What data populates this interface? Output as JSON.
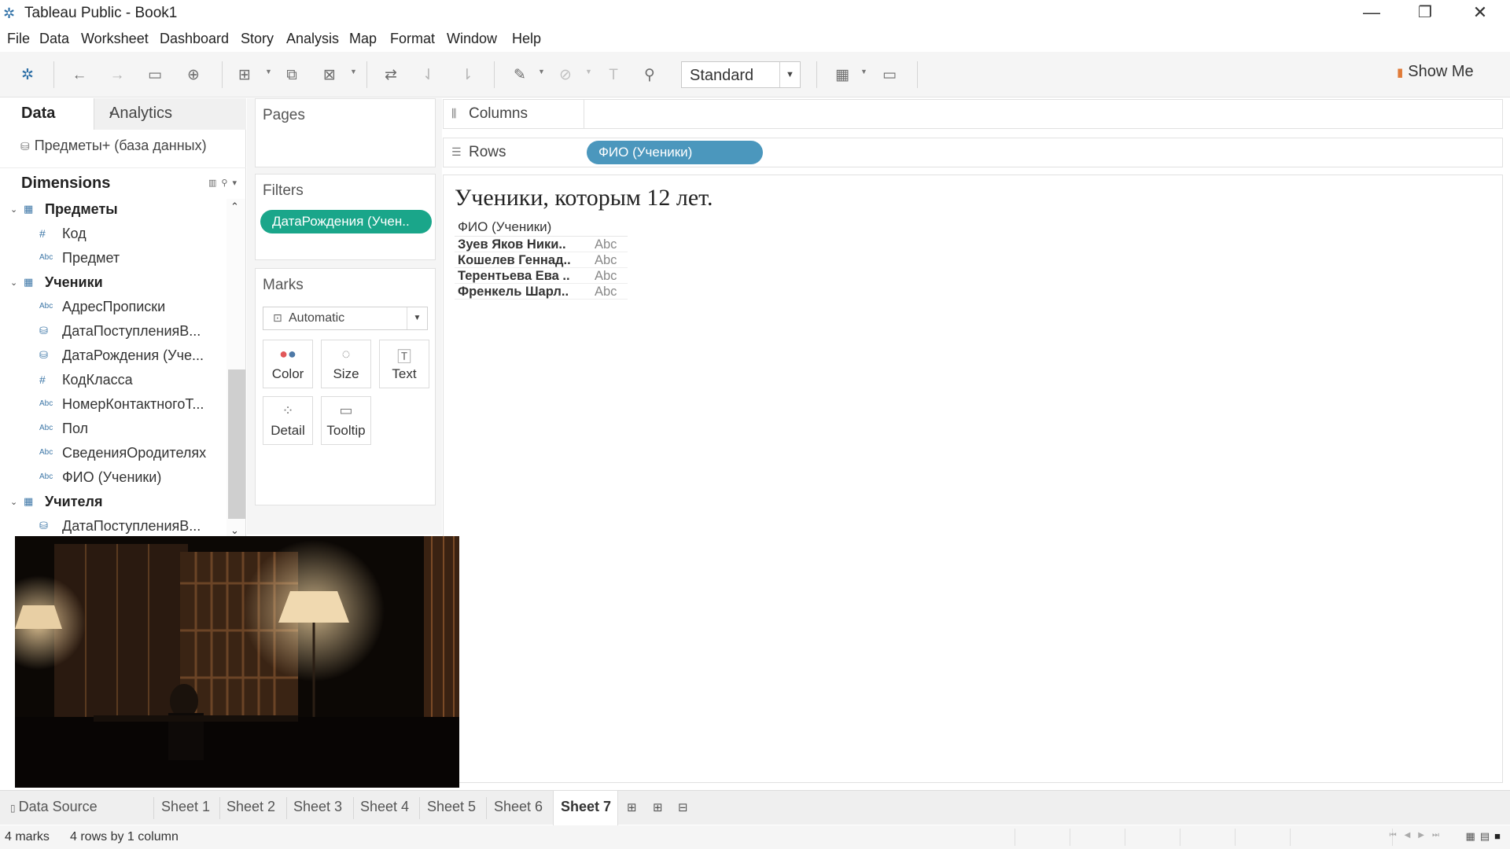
{
  "window": {
    "title": "Tableau Public - Book1",
    "controls": {
      "minimize": "—",
      "restore": "❐",
      "close": "✕"
    }
  },
  "menu": [
    "File",
    "Data",
    "Worksheet",
    "Dashboard",
    "Story",
    "Analysis",
    "Map",
    "Format",
    "Window",
    "Help"
  ],
  "toolbar": {
    "fit": "Standard",
    "show_me": "Show Me",
    "icons": [
      "tableau-logo-icon",
      "undo-icon",
      "redo-icon",
      "save-icon",
      "add-datasource-icon",
      "new-worksheet-icon",
      "duplicate-sheet-icon",
      "clear-sheet-icon",
      "swap-icon",
      "sort-ascending-icon",
      "sort-descending-icon",
      "highlight-icon",
      "group-icon",
      "show-labels-icon",
      "pin-icon",
      "show-cards-icon",
      "presentation-icon"
    ]
  },
  "data_pane": {
    "tab_data": "Data",
    "tab_analytics": "Analytics",
    "datasource": "Предметы+ (база данных)",
    "dimensions_label": "Dimensions",
    "tables": [
      {
        "name": "Предметы",
        "fields": [
          {
            "type": "#",
            "name": "Код"
          },
          {
            "type": "Abc",
            "name": "Предмет"
          }
        ]
      },
      {
        "name": "Ученики",
        "fields": [
          {
            "type": "Abc",
            "name": "АдресПрописки"
          },
          {
            "type": "date",
            "name": "ДатаПоступленияВ..."
          },
          {
            "type": "date",
            "name": "ДатаРождения (Уче..."
          },
          {
            "type": "#",
            "name": "КодКласса"
          },
          {
            "type": "Abc",
            "name": "НомерКонтактногоТ..."
          },
          {
            "type": "Abc",
            "name": "Пол"
          },
          {
            "type": "Abc",
            "name": "СведенияОродителях"
          },
          {
            "type": "Abc",
            "name": "ФИО (Ученики)"
          }
        ]
      },
      {
        "name": "Учителя",
        "fields": [
          {
            "type": "date",
            "name": "ДатаПоступленияВ..."
          }
        ]
      }
    ]
  },
  "cards": {
    "pages": "Pages",
    "filters": "Filters",
    "filter_pill": "ДатаРождения (Учен..",
    "marks": "Marks",
    "mark_type": "Automatic",
    "mark_buttons": [
      {
        "label": "Color",
        "icon": "color-icon"
      },
      {
        "label": "Size",
        "icon": "size-icon"
      },
      {
        "label": "Text",
        "icon": "text-icon"
      },
      {
        "label": "Detail",
        "icon": "detail-icon"
      },
      {
        "label": "Tooltip",
        "icon": "tooltip-icon"
      }
    ]
  },
  "shelves": {
    "columns_label": "Columns",
    "rows_label": "Rows",
    "rows_pill": "ФИО (Ученики)"
  },
  "view": {
    "title": "Ученики, которым 12 лет.",
    "column_header": "ФИО (Ученики)",
    "rows": [
      {
        "name": "Зуев Яков Ники..",
        "mark": "Abc"
      },
      {
        "name": "Кошелев Геннад..",
        "mark": "Abc"
      },
      {
        "name": "Терентьева Ева ..",
        "mark": "Abc"
      },
      {
        "name": "Френкель Шарл..",
        "mark": "Abc"
      }
    ]
  },
  "sheet_tabs": {
    "data_source": "Data Source",
    "sheets": [
      "Sheet 1",
      "Sheet 2",
      "Sheet 3",
      "Sheet 4",
      "Sheet 5",
      "Sheet 6",
      "Sheet 7"
    ],
    "active": "Sheet 7"
  },
  "status": {
    "marks": "4 marks",
    "dims": "4 rows by 1 column"
  },
  "colors": {
    "filter_pill": "#1aa68a",
    "dimension_pill": "#4b97bd"
  }
}
